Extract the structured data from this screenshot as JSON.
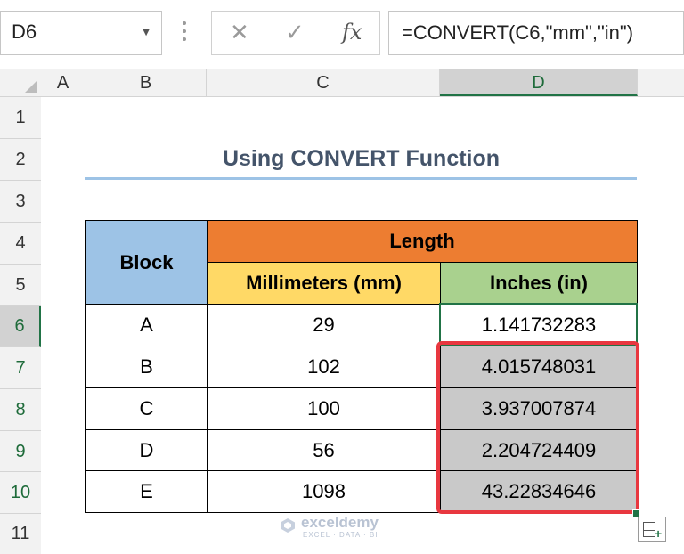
{
  "formula_bar": {
    "name_box": "D6",
    "cancel_icon": "✕",
    "enter_icon": "✓",
    "fx_label": "fx",
    "formula": "=CONVERT(C6,\"mm\",\"in\")"
  },
  "column_headers": [
    "A",
    "B",
    "C",
    "D"
  ],
  "row_headers": [
    "1",
    "2",
    "3",
    "4",
    "5",
    "6",
    "7",
    "8",
    "9",
    "10",
    "11"
  ],
  "title": "Using CONVERT Function",
  "table": {
    "block_header": "Block",
    "length_header": "Length",
    "mm_header": "Millimeters (mm)",
    "in_header": "Inches (in)",
    "rows": [
      {
        "block": "A",
        "mm": "29",
        "inches": "1.141732283"
      },
      {
        "block": "B",
        "mm": "102",
        "inches": "4.015748031"
      },
      {
        "block": "C",
        "mm": "100",
        "inches": "3.937007874"
      },
      {
        "block": "D",
        "mm": "56",
        "inches": "2.204724409"
      },
      {
        "block": "E",
        "mm": "1098",
        "inches": "43.22834646"
      }
    ]
  },
  "watermark": {
    "name": "exceldemy",
    "tagline": "EXCEL · DATA · BI"
  },
  "colors": {
    "block_header": "#9dc3e6",
    "length_header": "#ed7d31",
    "mm_header": "#ffd966",
    "in_header": "#a9d18e",
    "selection_highlight": "#c9c9c9",
    "red_outline": "#e8373f",
    "excel_green": "#217346",
    "title_text": "#44546a"
  }
}
